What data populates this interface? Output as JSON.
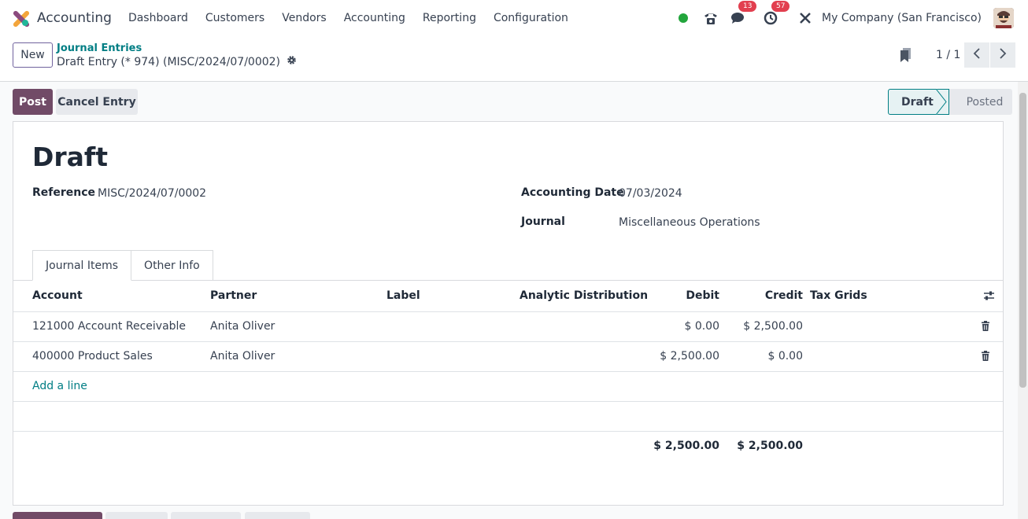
{
  "navbar": {
    "app_name": "Accounting",
    "menu": [
      "Dashboard",
      "Customers",
      "Vendors",
      "Accounting",
      "Reporting",
      "Configuration"
    ],
    "messages_count": "13",
    "activities_count": "57",
    "company": "My Company (San Francisco)"
  },
  "control": {
    "new_label": "New",
    "breadcrumb": "Journal Entries",
    "record": "Draft Entry (* 974) (MISC/2024/07/0002)",
    "pager": "1 / 1"
  },
  "actions": {
    "post": "Post",
    "cancel": "Cancel Entry",
    "stages": [
      "Draft",
      "Posted"
    ],
    "active_stage": "Draft"
  },
  "form": {
    "title": "Draft",
    "reference_label": "Reference",
    "reference_value": "MISC/2024/07/0002",
    "date_label": "Accounting Date",
    "date_value": "07/03/2024",
    "journal_label": "Journal",
    "journal_value": "Miscellaneous Operations",
    "tabs": [
      "Journal Items",
      "Other Info"
    ]
  },
  "table": {
    "columns": [
      "Account",
      "Partner",
      "Label",
      "Analytic Distribution",
      "Debit",
      "Credit",
      "Tax Grids"
    ],
    "rows": [
      {
        "account": "121000 Account Receivable",
        "partner": "Anita Oliver",
        "debit": "$ 0.00",
        "credit": "$ 2,500.00"
      },
      {
        "account": "400000 Product Sales",
        "partner": "Anita Oliver",
        "debit": "$ 2,500.00",
        "credit": "$ 0.00"
      }
    ],
    "add_line": "Add a line",
    "total_debit": "$ 2,500.00",
    "total_credit": "$ 2,500.00"
  },
  "colors": {
    "brand": "#714b67",
    "link": "#017e84",
    "badge": "#e23f4f",
    "online": "#22a53c"
  }
}
